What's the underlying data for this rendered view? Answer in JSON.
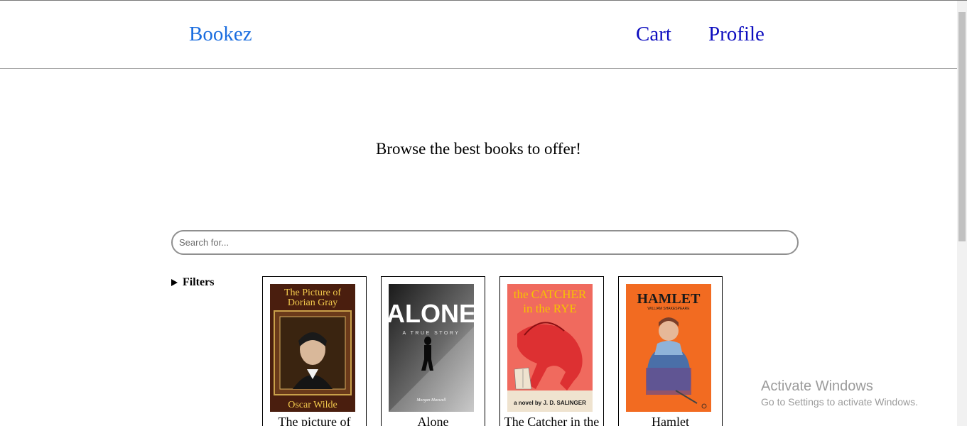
{
  "header": {
    "brand": "Bookez",
    "nav": {
      "cart": "Cart",
      "profile": "Profile"
    }
  },
  "hero": {
    "tagline": "Browse the best books to offer!"
  },
  "search": {
    "placeholder": "Search for...",
    "value": ""
  },
  "filters": {
    "label": "Filters"
  },
  "books": [
    {
      "title": "The picture of Dorian Gray",
      "cover": {
        "title_line1": "The Picture of",
        "title_line2": "Dorian Gray",
        "author": "Oscar Wilde",
        "colors": {
          "background": "#4a1e0e",
          "text": "#f2c94c"
        }
      }
    },
    {
      "title": "Alone",
      "cover": {
        "title": "ALONE",
        "subtitle": "A TRUE STORY",
        "author": "Morgan Maxwell",
        "colors": {
          "background": "#2b2b2b",
          "text": "#ffffff"
        }
      }
    },
    {
      "title": "The Catcher in the Rye",
      "cover": {
        "title_line1": "the CATCHER",
        "title_line2": "in the RYE",
        "author": "a novel by J. D. SALINGER",
        "colors": {
          "background": "#f06a5e",
          "text": "#f5c400"
        }
      }
    },
    {
      "title": "Hamlet",
      "cover": {
        "title": "HAMLET",
        "author": "WILLIAM SHAKESPEARE",
        "colors": {
          "background": "#f26b21",
          "text": "#1a1a1a"
        }
      }
    }
  ],
  "watermark": {
    "title": "Activate Windows",
    "subtitle": "Go to Settings to activate Windows."
  },
  "colors": {
    "brand": "#1a6ddf",
    "nav": "#0d0dbf",
    "search_border": "#8f8f8f"
  }
}
